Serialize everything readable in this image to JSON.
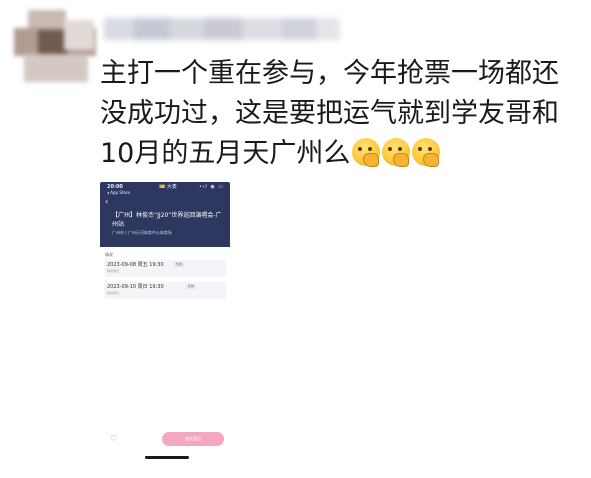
{
  "post": {
    "line1": "主打一个重在参与，今年抢票一场都还",
    "line2": "没成功过，这是要把运气就到学友哥和",
    "line3": "10月的五月天广州么",
    "emojis": [
      "thinking-face-emoji",
      "thinking-face-emoji",
      "thinking-face-emoji"
    ]
  },
  "phone": {
    "status_time": "20:00",
    "status_store": "◂ App Store",
    "status_center": "🎫 大麦",
    "status_right": "•ıl ◉ ▭",
    "back": "‹",
    "title": "【广州】林俊杰“JJ20”世界巡回演唱会-广州站",
    "venue": "广州市 | 广州天河体育中心体育场",
    "session_label": "场次",
    "sessions": [
      {
        "date": "2023-09-08 周五 19:30",
        "sub": "缺货登记",
        "tag": "售罄"
      },
      {
        "date": "2023-09-10 周日 19:30",
        "sub": "缺货登记",
        "tag": "售罄"
      }
    ]
  },
  "bottom": {
    "heart": "♡",
    "button": "缺货登记"
  },
  "colors": {
    "phone_header": "#2d3760",
    "buy_button": "#f5a6c1",
    "text": "#1a1a1a"
  }
}
